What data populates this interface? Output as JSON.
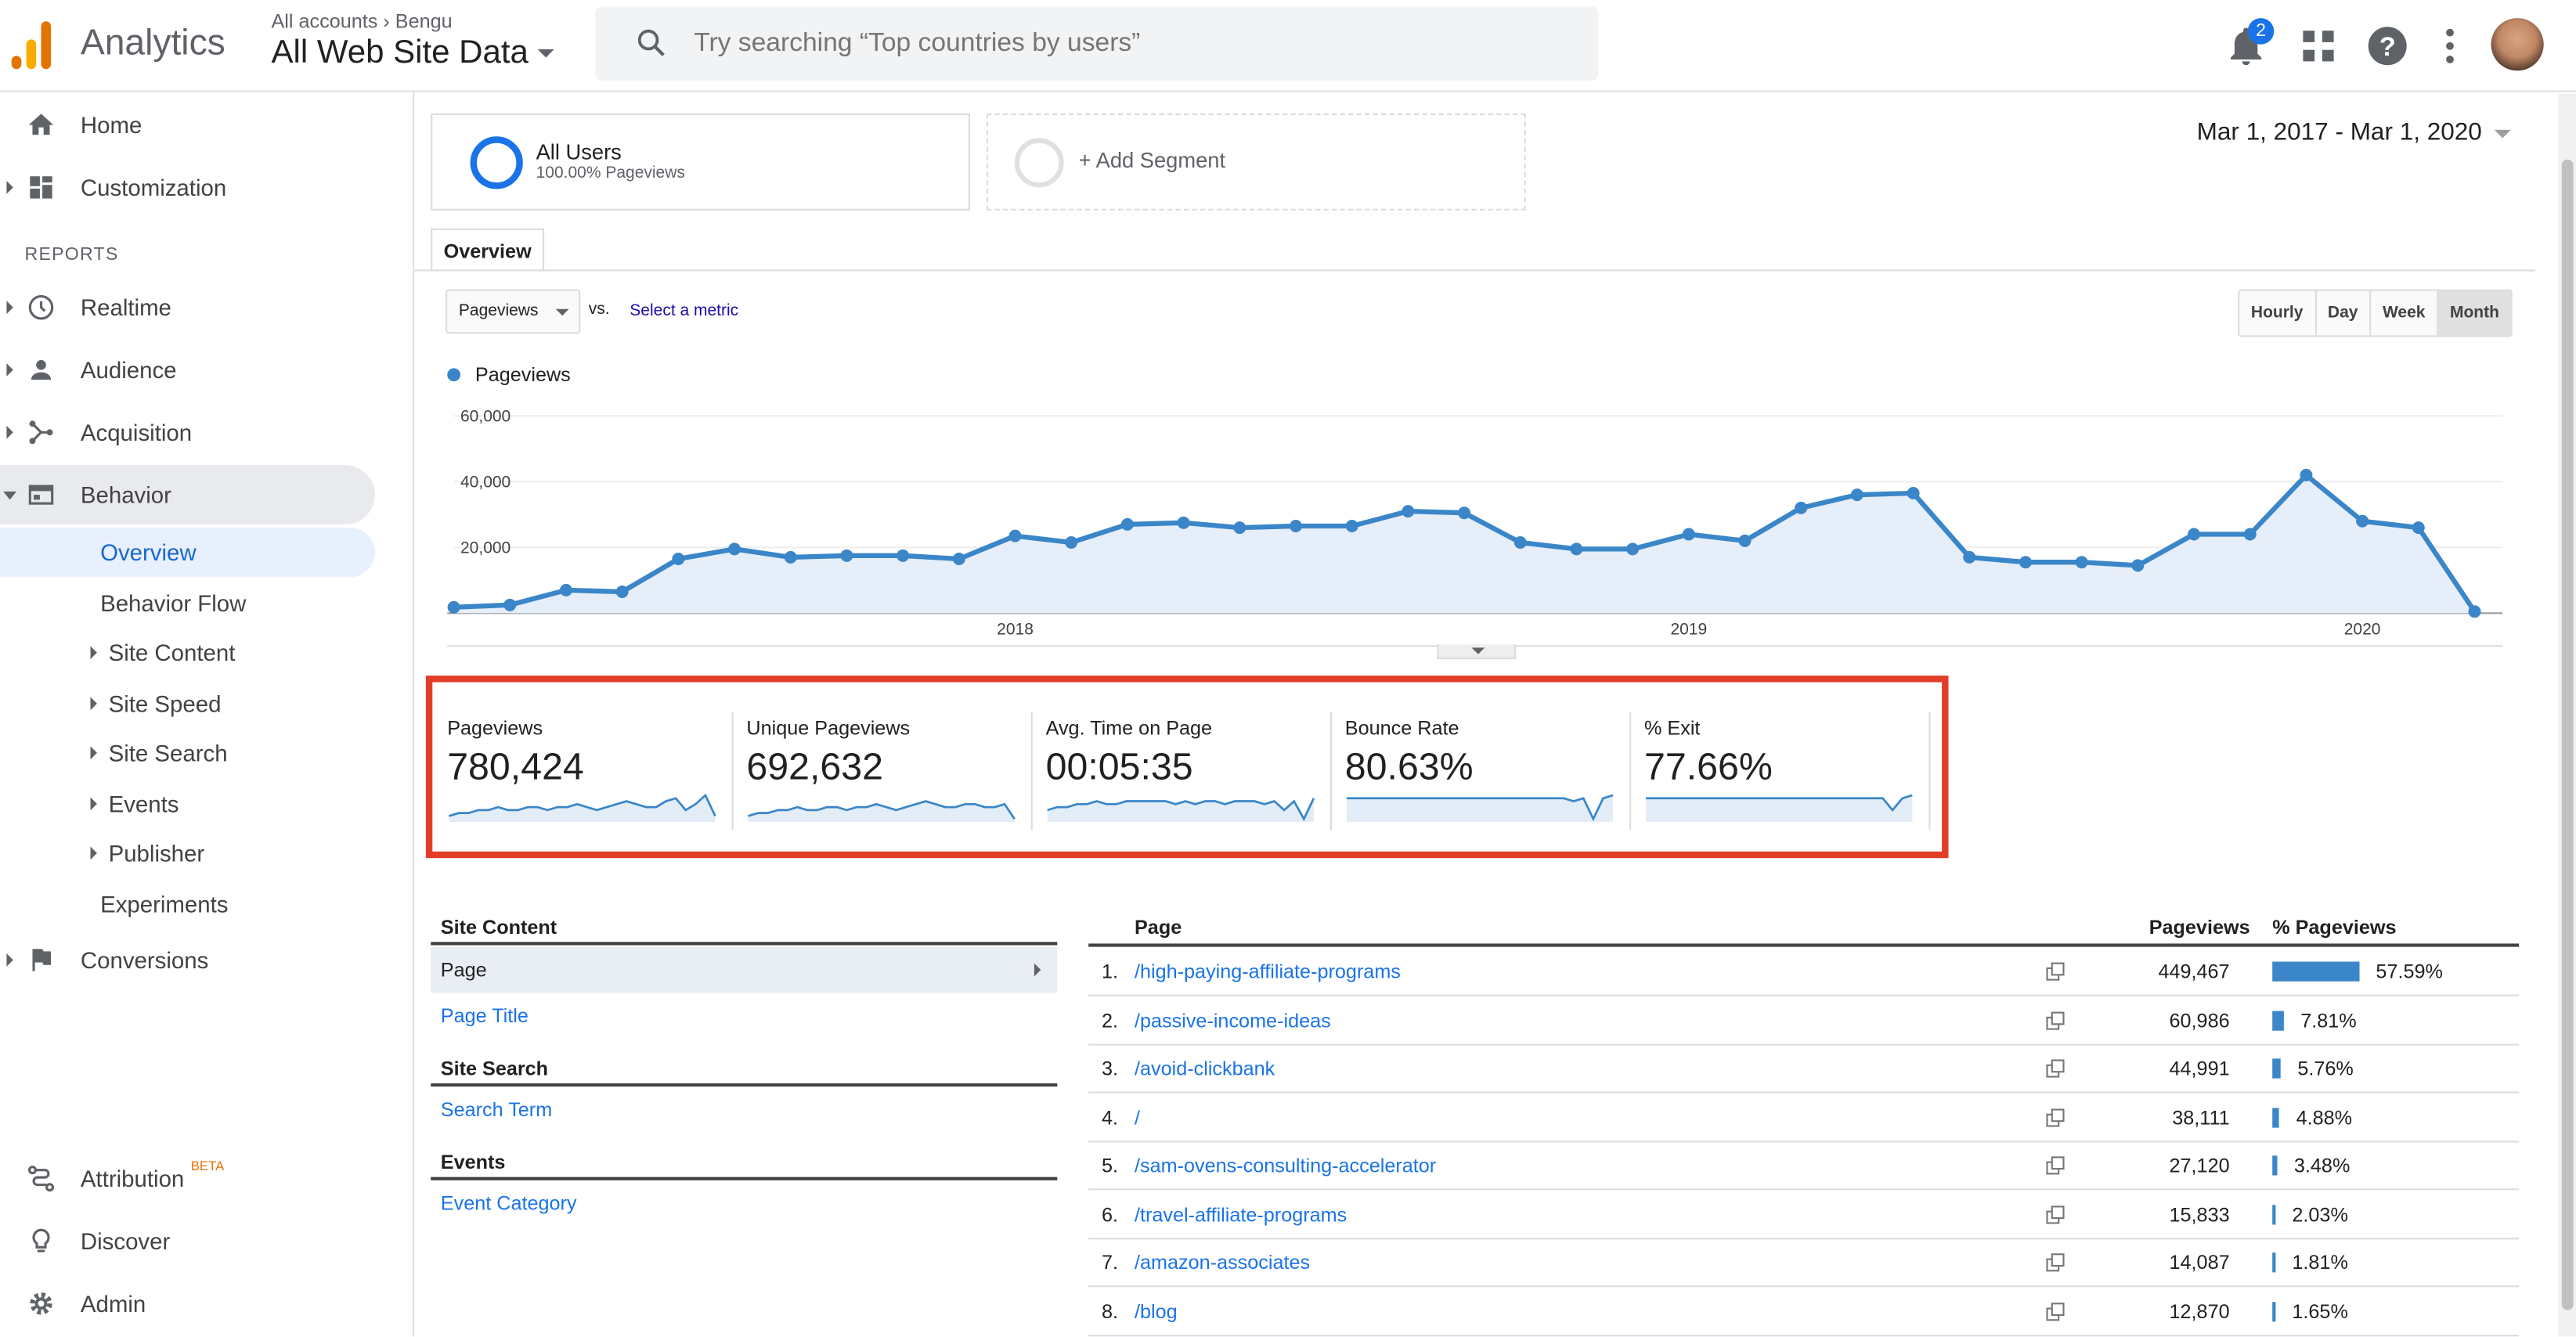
{
  "header": {
    "app_name": "Analytics",
    "breadcrumb": "All accounts  ›  Bengu",
    "property": "All Web Site Data",
    "search_placeholder": "Try searching “Top countries by users”",
    "notification_count": "2"
  },
  "sidebar": {
    "reports_label": "REPORTS",
    "home": "Home",
    "customization": "Customization",
    "realtime": "Realtime",
    "audience": "Audience",
    "acquisition": "Acquisition",
    "behavior": "Behavior",
    "behavior_sub": [
      "Overview",
      "Behavior Flow",
      "Site Content",
      "Site Speed",
      "Site Search",
      "Events",
      "Publisher",
      "Experiments"
    ],
    "conversions": "Conversions",
    "attribution": "Attribution",
    "attribution_badge": "BETA",
    "discover": "Discover",
    "admin": "Admin"
  },
  "segments": {
    "all_users_title": "All Users",
    "all_users_sub": "100.00% Pageviews",
    "add_segment": "+ Add Segment"
  },
  "date_range": "Mar 1, 2017 - Mar 1, 2020",
  "tab": "Overview",
  "metric_select": "Pageviews",
  "vs_label": "vs.",
  "select_metric_link": "Select a metric",
  "granularity": [
    "Hourly",
    "Day",
    "Week",
    "Month"
  ],
  "granularity_selected": "Month",
  "chart_data": {
    "type": "area",
    "series": [
      {
        "name": "Pageviews",
        "values": [
          1800,
          2500,
          7000,
          6500,
          16500,
          19500,
          17000,
          17500,
          17500,
          16500,
          23500,
          21500,
          27000,
          27500,
          26000,
          26500,
          26500,
          31000,
          30500,
          21500,
          19500,
          19500,
          24000,
          22000,
          32000,
          36000,
          36500,
          17000,
          15500,
          15500,
          14500,
          24000,
          24000,
          42000,
          28000,
          26000,
          500
        ]
      }
    ],
    "x_tick_labels": [
      "2018",
      "2019",
      "2020"
    ],
    "y_tick_labels": [
      "60,000",
      "40,000",
      "20,000"
    ],
    "ylim": [
      0,
      60000
    ],
    "color": "#3a86c8"
  },
  "scorecards": [
    {
      "label": "Pageviews",
      "value": "780,424"
    },
    {
      "label": "Unique Pageviews",
      "value": "692,632"
    },
    {
      "label": "Avg. Time on Page",
      "value": "00:05:35"
    },
    {
      "label": "Bounce Rate",
      "value": "80.63%"
    },
    {
      "label": "% Exit",
      "value": "77.66%"
    }
  ],
  "site_content": {
    "heading": "Site Content",
    "page": "Page",
    "page_title": "Page Title",
    "search_heading": "Site Search",
    "search_term": "Search Term",
    "events_heading": "Events",
    "event_category": "Event Category"
  },
  "table": {
    "col_page": "Page",
    "col_pageviews": "Pageviews",
    "col_pct": "% Pageviews",
    "rows": [
      {
        "n": "1.",
        "page": "/high-paying-affiliate-programs",
        "pv": "449,467",
        "pct": "57.59%",
        "frac": 0.5759
      },
      {
        "n": "2.",
        "page": "/passive-income-ideas",
        "pv": "60,986",
        "pct": "7.81%",
        "frac": 0.0781
      },
      {
        "n": "3.",
        "page": "/avoid-clickbank",
        "pv": "44,991",
        "pct": "5.76%",
        "frac": 0.0576
      },
      {
        "n": "4.",
        "page": "/",
        "pv": "38,111",
        "pct": "4.88%",
        "frac": 0.0488
      },
      {
        "n": "5.",
        "page": "/sam-ovens-consulting-accelerator",
        "pv": "27,120",
        "pct": "3.48%",
        "frac": 0.0348
      },
      {
        "n": "6.",
        "page": "/travel-affiliate-programs",
        "pv": "15,833",
        "pct": "2.03%",
        "frac": 0.0203
      },
      {
        "n": "7.",
        "page": "/amazon-associates",
        "pv": "14,087",
        "pct": "1.81%",
        "frac": 0.0181
      },
      {
        "n": "8.",
        "page": "/blog",
        "pv": "12,870",
        "pct": "1.65%",
        "frac": 0.0165
      }
    ]
  }
}
